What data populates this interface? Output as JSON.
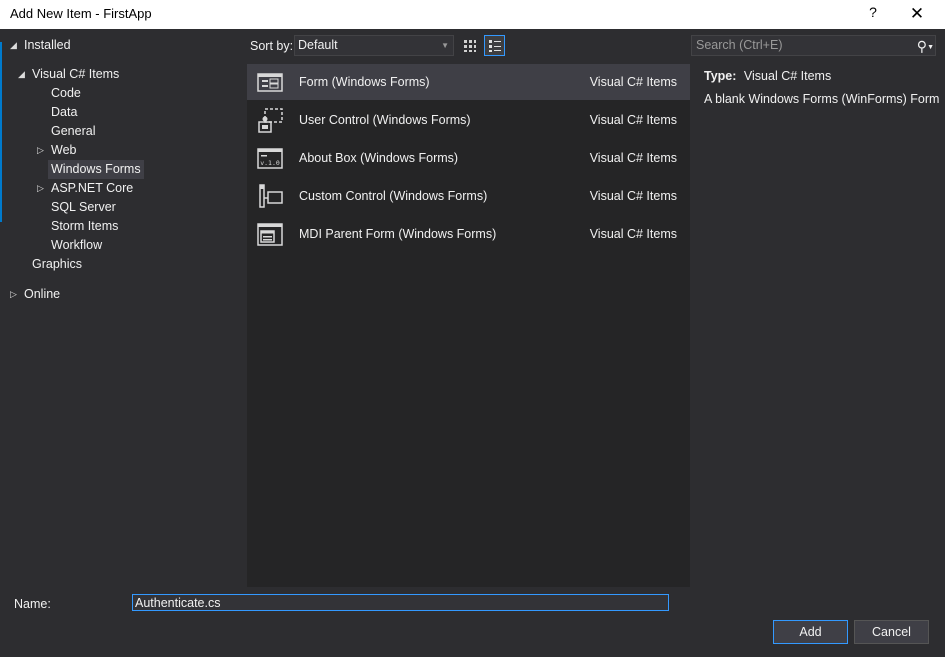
{
  "window": {
    "title": "Add New Item - FirstApp",
    "help_glyph": "?",
    "close_glyph": "✕"
  },
  "tree": {
    "installed": "Installed",
    "visual_csharp": "Visual C# Items",
    "children": [
      "Code",
      "Data",
      "General",
      "Web",
      "Windows Forms",
      "ASP.NET Core",
      "SQL Server",
      "Storm Items",
      "Workflow"
    ],
    "graphics": "Graphics",
    "online": "Online",
    "selected": "Windows Forms"
  },
  "toolbar": {
    "sort_label": "Sort by:",
    "sort_value": "Default",
    "search_placeholder": "Search (Ctrl+E)"
  },
  "templates": [
    {
      "icon": "form-icon",
      "name": "Form (Windows Forms)",
      "category": "Visual C# Items",
      "selected": true
    },
    {
      "icon": "user-control-icon",
      "name": "User Control (Windows Forms)",
      "category": "Visual C# Items",
      "selected": false
    },
    {
      "icon": "about-box-icon",
      "name": "About Box (Windows Forms)",
      "category": "Visual C# Items",
      "selected": false
    },
    {
      "icon": "custom-control-icon",
      "name": "Custom Control (Windows Forms)",
      "category": "Visual C# Items",
      "selected": false
    },
    {
      "icon": "mdi-parent-form-icon",
      "name": "MDI Parent Form (Windows Forms)",
      "category": "Visual C# Items",
      "selected": false
    }
  ],
  "about_icon_text": "v.1.0",
  "details": {
    "type_label": "Type:",
    "type_value": "Visual C# Items",
    "description": "A blank Windows Forms (WinForms) Form"
  },
  "footer": {
    "name_label": "Name:",
    "name_value": "Authenticate.cs",
    "add_label": "Add",
    "cancel_label": "Cancel"
  },
  "colors": {
    "background": "#2d2d30",
    "list_background": "#252526",
    "selection": "#3f3f46",
    "accent": "#3399ff"
  }
}
